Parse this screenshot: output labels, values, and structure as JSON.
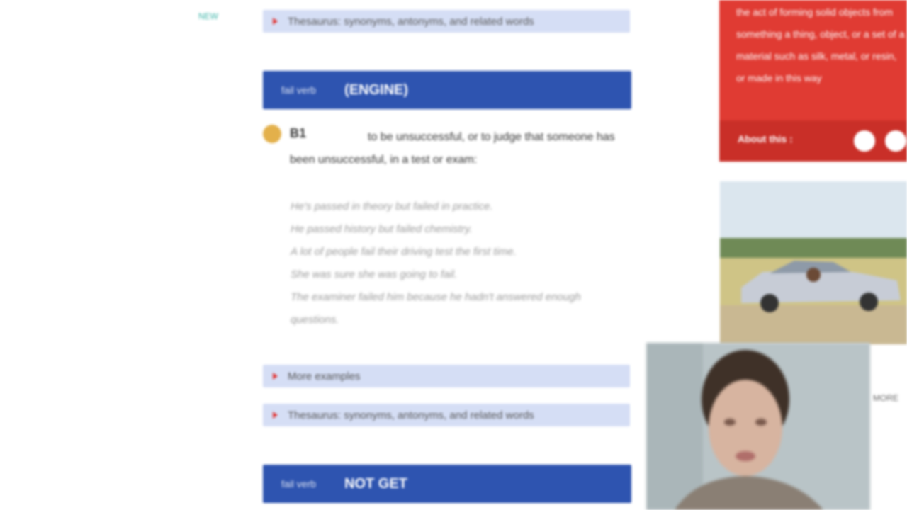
{
  "sidebar": {
    "link": "NEW"
  },
  "accordions": {
    "top": "Thesaurus: synonyms, antonyms, and related words",
    "idioms": "More examples",
    "thesaurus": "Thesaurus: synonyms, antonyms, and related words"
  },
  "entries": [
    {
      "pos": "fail verb",
      "word": "(ENGINE)"
    },
    {
      "pos": "fail verb",
      "word": "NOT GET"
    }
  ],
  "definition": {
    "level": "B1",
    "code": "B1",
    "text": "to be unsuccessful, or to judge that someone has been unsuccessful, in a test or exam:"
  },
  "examples": [
    "He's passed in theory but failed in practice.",
    "He passed history but failed chemistry.",
    "A lot of people fail their driving test the first time.",
    "She was sure she was going to fail.",
    "The examiner failed him because he hadn't answered enough questions."
  ],
  "red_card": {
    "text": "the act of forming solid objects from something a thing, object, or a set of a material such as silk, metal, or resin, or made in this way",
    "about": "About this :"
  },
  "faint_text": "MORE"
}
